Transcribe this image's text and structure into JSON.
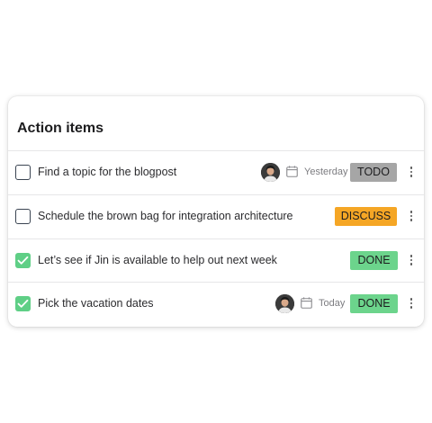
{
  "panel": {
    "title": "Action items"
  },
  "tasks": [
    {
      "label": "Find a topic for the blogpost",
      "checked": false,
      "has_avatar": true,
      "date": "Yesterday",
      "status": "TODO",
      "status_color": "#a6a6a6"
    },
    {
      "label": "Schedule the brown bag for integration architecture",
      "checked": false,
      "has_avatar": false,
      "date": "",
      "status": "DISCUSS",
      "status_color": "#f5a625"
    },
    {
      "label": "Let’s see if Jin is available to help out next week",
      "checked": true,
      "has_avatar": false,
      "date": "",
      "status": "DONE",
      "status_color": "#6cd48c"
    },
    {
      "label": "Pick the vacation dates",
      "checked": true,
      "has_avatar": true,
      "date": "Today",
      "status": "DONE",
      "status_color": "#6cd48c"
    }
  ],
  "icons": {
    "checkbox": "checkbox-icon",
    "checkmark": "checkmark-icon",
    "calendar": "calendar-icon",
    "more": "more-vertical-icon"
  },
  "colors": {
    "checked": "#5fcf86",
    "todo": "#a6a6a6",
    "discuss": "#f5a625",
    "done": "#6cd48c"
  }
}
